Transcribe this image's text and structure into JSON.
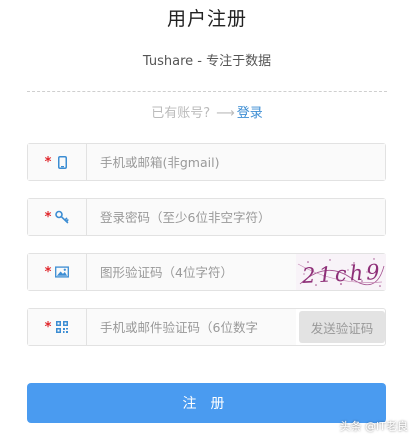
{
  "page": {
    "title": "用户注册",
    "subtitle": "Tushare - 专注于数据"
  },
  "login": {
    "prompt": "已有账号?",
    "arrow": "⟶",
    "link_label": "登录"
  },
  "form": {
    "required_mark": "*",
    "account": {
      "placeholder": "手机或邮箱(非gmail)",
      "value": "",
      "icon": "mobile-phone-icon"
    },
    "password": {
      "placeholder": "登录密码（至少6位非空字符）",
      "value": "",
      "icon": "key-icon"
    },
    "captcha": {
      "placeholder": "图形验证码（4位字符）",
      "value": "",
      "icon": "image-icon",
      "image_text": "21ch9"
    },
    "verify_code": {
      "placeholder": "手机或邮件验证码（6位数字",
      "value": "",
      "icon": "qrcode-icon"
    },
    "send_code_label": "发送验证码",
    "submit_label": "注册"
  },
  "watermark": {
    "text": "头条 @IT老良"
  },
  "colors": {
    "accent": "#4a9bf0",
    "link": "#3c8dd3",
    "required": "#e0262b",
    "icon": "#3c8dd3"
  }
}
